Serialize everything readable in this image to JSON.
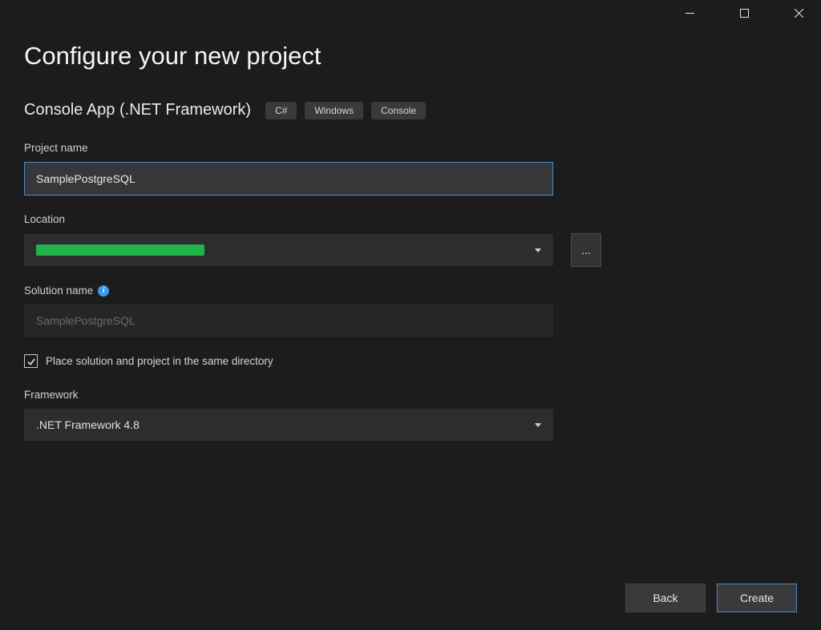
{
  "window": {
    "minimize": "minimize",
    "maximize": "maximize",
    "close": "close"
  },
  "page": {
    "title": "Configure your new project",
    "subtitle": "Console App (.NET Framework)",
    "tags": [
      "C#",
      "Windows",
      "Console"
    ]
  },
  "fields": {
    "projectName": {
      "label": "Project name",
      "value": "SamplePostgreSQL"
    },
    "location": {
      "label": "Location",
      "value_redacted": true,
      "browse": "..."
    },
    "solutionName": {
      "label": "Solution name",
      "value": "SamplePostgreSQL",
      "info": "i"
    },
    "sameDirectory": {
      "checked": true,
      "label": "Place solution and project in the same directory"
    },
    "framework": {
      "label": "Framework",
      "value": ".NET Framework 4.8"
    }
  },
  "footer": {
    "back": "Back",
    "create": "Create"
  }
}
